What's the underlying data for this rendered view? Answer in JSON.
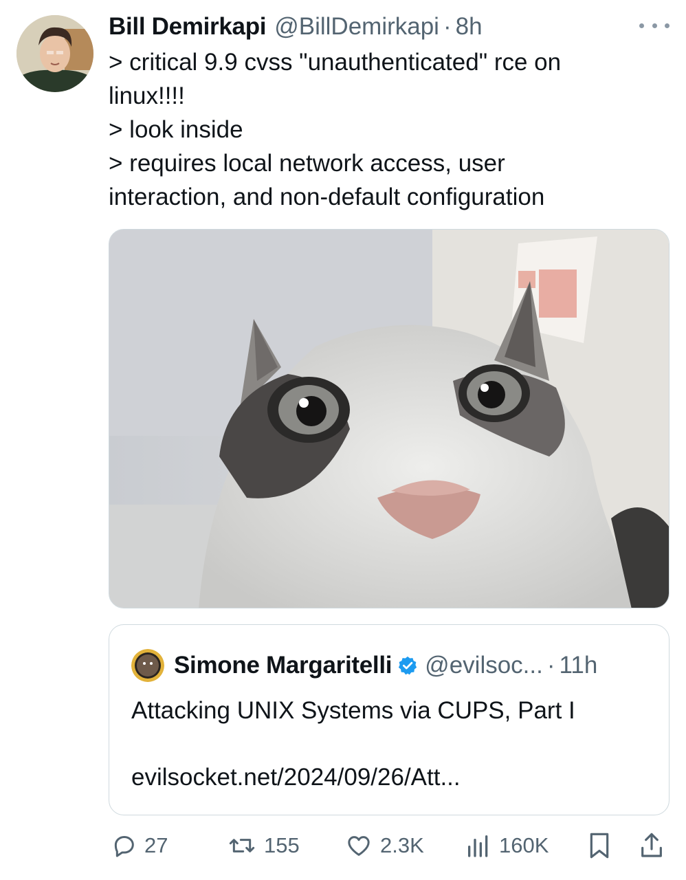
{
  "tweet": {
    "author": {
      "display_name": "Bill Demirkapi",
      "handle": "@BillDemirkapi",
      "separator": "·",
      "time": "8h"
    },
    "text_lines": [
      "> critical 9.9 cvss \"unauthenticated\" rce on",
      "linux!!!!",
      "> look inside",
      "> requires local network access, user",
      "interaction, and non-default configuration"
    ],
    "media_icon": "cat-photo",
    "more_icon": "more-dots-icon"
  },
  "quote": {
    "author": {
      "display_name": "Simone Margaritelli",
      "handle": "@evilsoc...",
      "separator": "·",
      "time": "11h"
    },
    "verified_icon": "verified-badge-icon",
    "text": "Attacking UNIX Systems via CUPS, Part I",
    "link": "evilsocket.net/2024/09/26/Att..."
  },
  "actions": {
    "reply": {
      "icon": "reply-icon",
      "count": "27"
    },
    "retweet": {
      "icon": "retweet-icon",
      "count": "155"
    },
    "like": {
      "icon": "heart-icon",
      "count": "2.3K"
    },
    "views": {
      "icon": "views-icon",
      "count": "160K"
    },
    "bookmark": {
      "icon": "bookmark-icon"
    },
    "share": {
      "icon": "share-icon"
    }
  },
  "colors": {
    "text": "#0f1419",
    "secondary": "#536471",
    "verified": "#1d9bf0",
    "border": "#cfd9de"
  }
}
